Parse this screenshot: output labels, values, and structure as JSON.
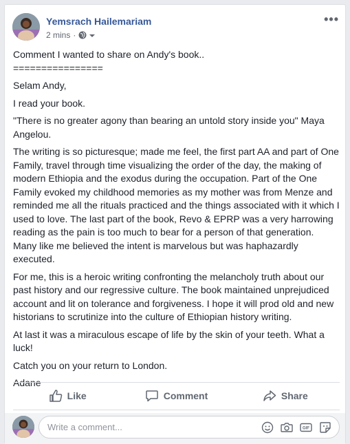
{
  "post": {
    "author": "Yemsrach Hailemariam",
    "time": "2 mins",
    "separator": "·",
    "more": "•••",
    "paragraphs": [
      "Comment I wanted to share on Andy's book..\n================",
      "Selam Andy,",
      "I read your book.",
      "\"There is no greater agony than bearing an untold story inside you\" Maya Angelou.",
      "The writing is so picturesque; made me feel, the first part AA and part of One Family, travel through time visualizing the order of the day, the making of modern Ethiopia and the exodus during the occupation. Part of the One Family evoked my childhood memories as my mother was from Menze and reminded me all the rituals practiced and the things associated with it which I used to love. The last part of the book, Revo & EPRP was a very harrowing reading as the pain is too much to bear for a person of that generation. Many like me believed the intent is marvelous but was haphazardly executed.",
      "For me, this is a heroic writing confronting the melancholy truth about our past history and our regressive culture. The book maintained unprejudiced account and lit on tolerance and forgiveness. I hope it will prod old and new historians to scrutinize into the culture of Ethiopian history writing.",
      "At last it was a miraculous escape of life by the skin of your teeth. What a luck!",
      "Catch you on your return to London.",
      "Adane"
    ]
  },
  "actions": {
    "like": "Like",
    "comment": "Comment",
    "share": "Share"
  },
  "comment_input": {
    "placeholder": "Write a comment..."
  },
  "colors": {
    "author_link": "#365899",
    "background": "#e9ebee",
    "action_text": "#606770"
  }
}
